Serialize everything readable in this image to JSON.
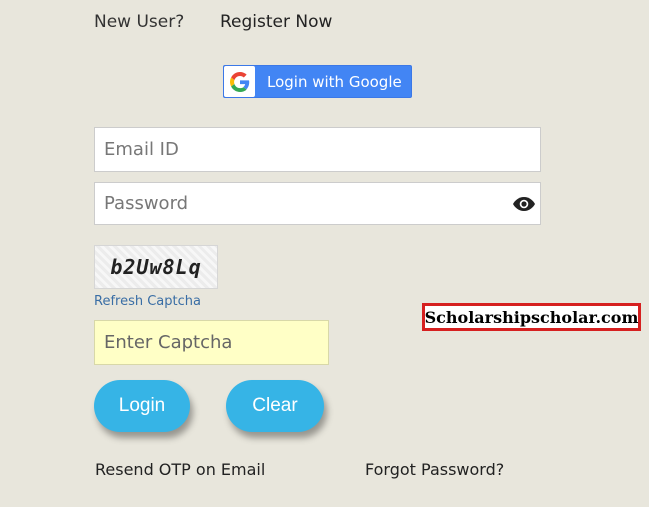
{
  "header": {
    "new_user_text": "New User?",
    "register_label": "Register Now"
  },
  "google_login": {
    "label": "Login with Google",
    "icon": "google-g-icon",
    "color": "#4285f4"
  },
  "form": {
    "email_placeholder": "Email ID",
    "email_value": "",
    "password_placeholder": "Password",
    "password_value": "",
    "password_toggle_icon": "eye-icon",
    "captcha_text": "b2Uw8Lq",
    "refresh_captcha_label": "Refresh Captcha",
    "captcha_placeholder": "Enter Captcha",
    "captcha_value": "",
    "captcha_field_color": "#ffffc6"
  },
  "actions": {
    "login_label": "Login",
    "clear_label": "Clear",
    "button_color": "#36b4e6"
  },
  "footer_links": {
    "resend_otp_label": "Resend OTP on Email",
    "forgot_password_label": "Forgot Password?"
  },
  "watermark": {
    "text": "Scholarshipscholar.com",
    "border_color": "#d62020"
  }
}
